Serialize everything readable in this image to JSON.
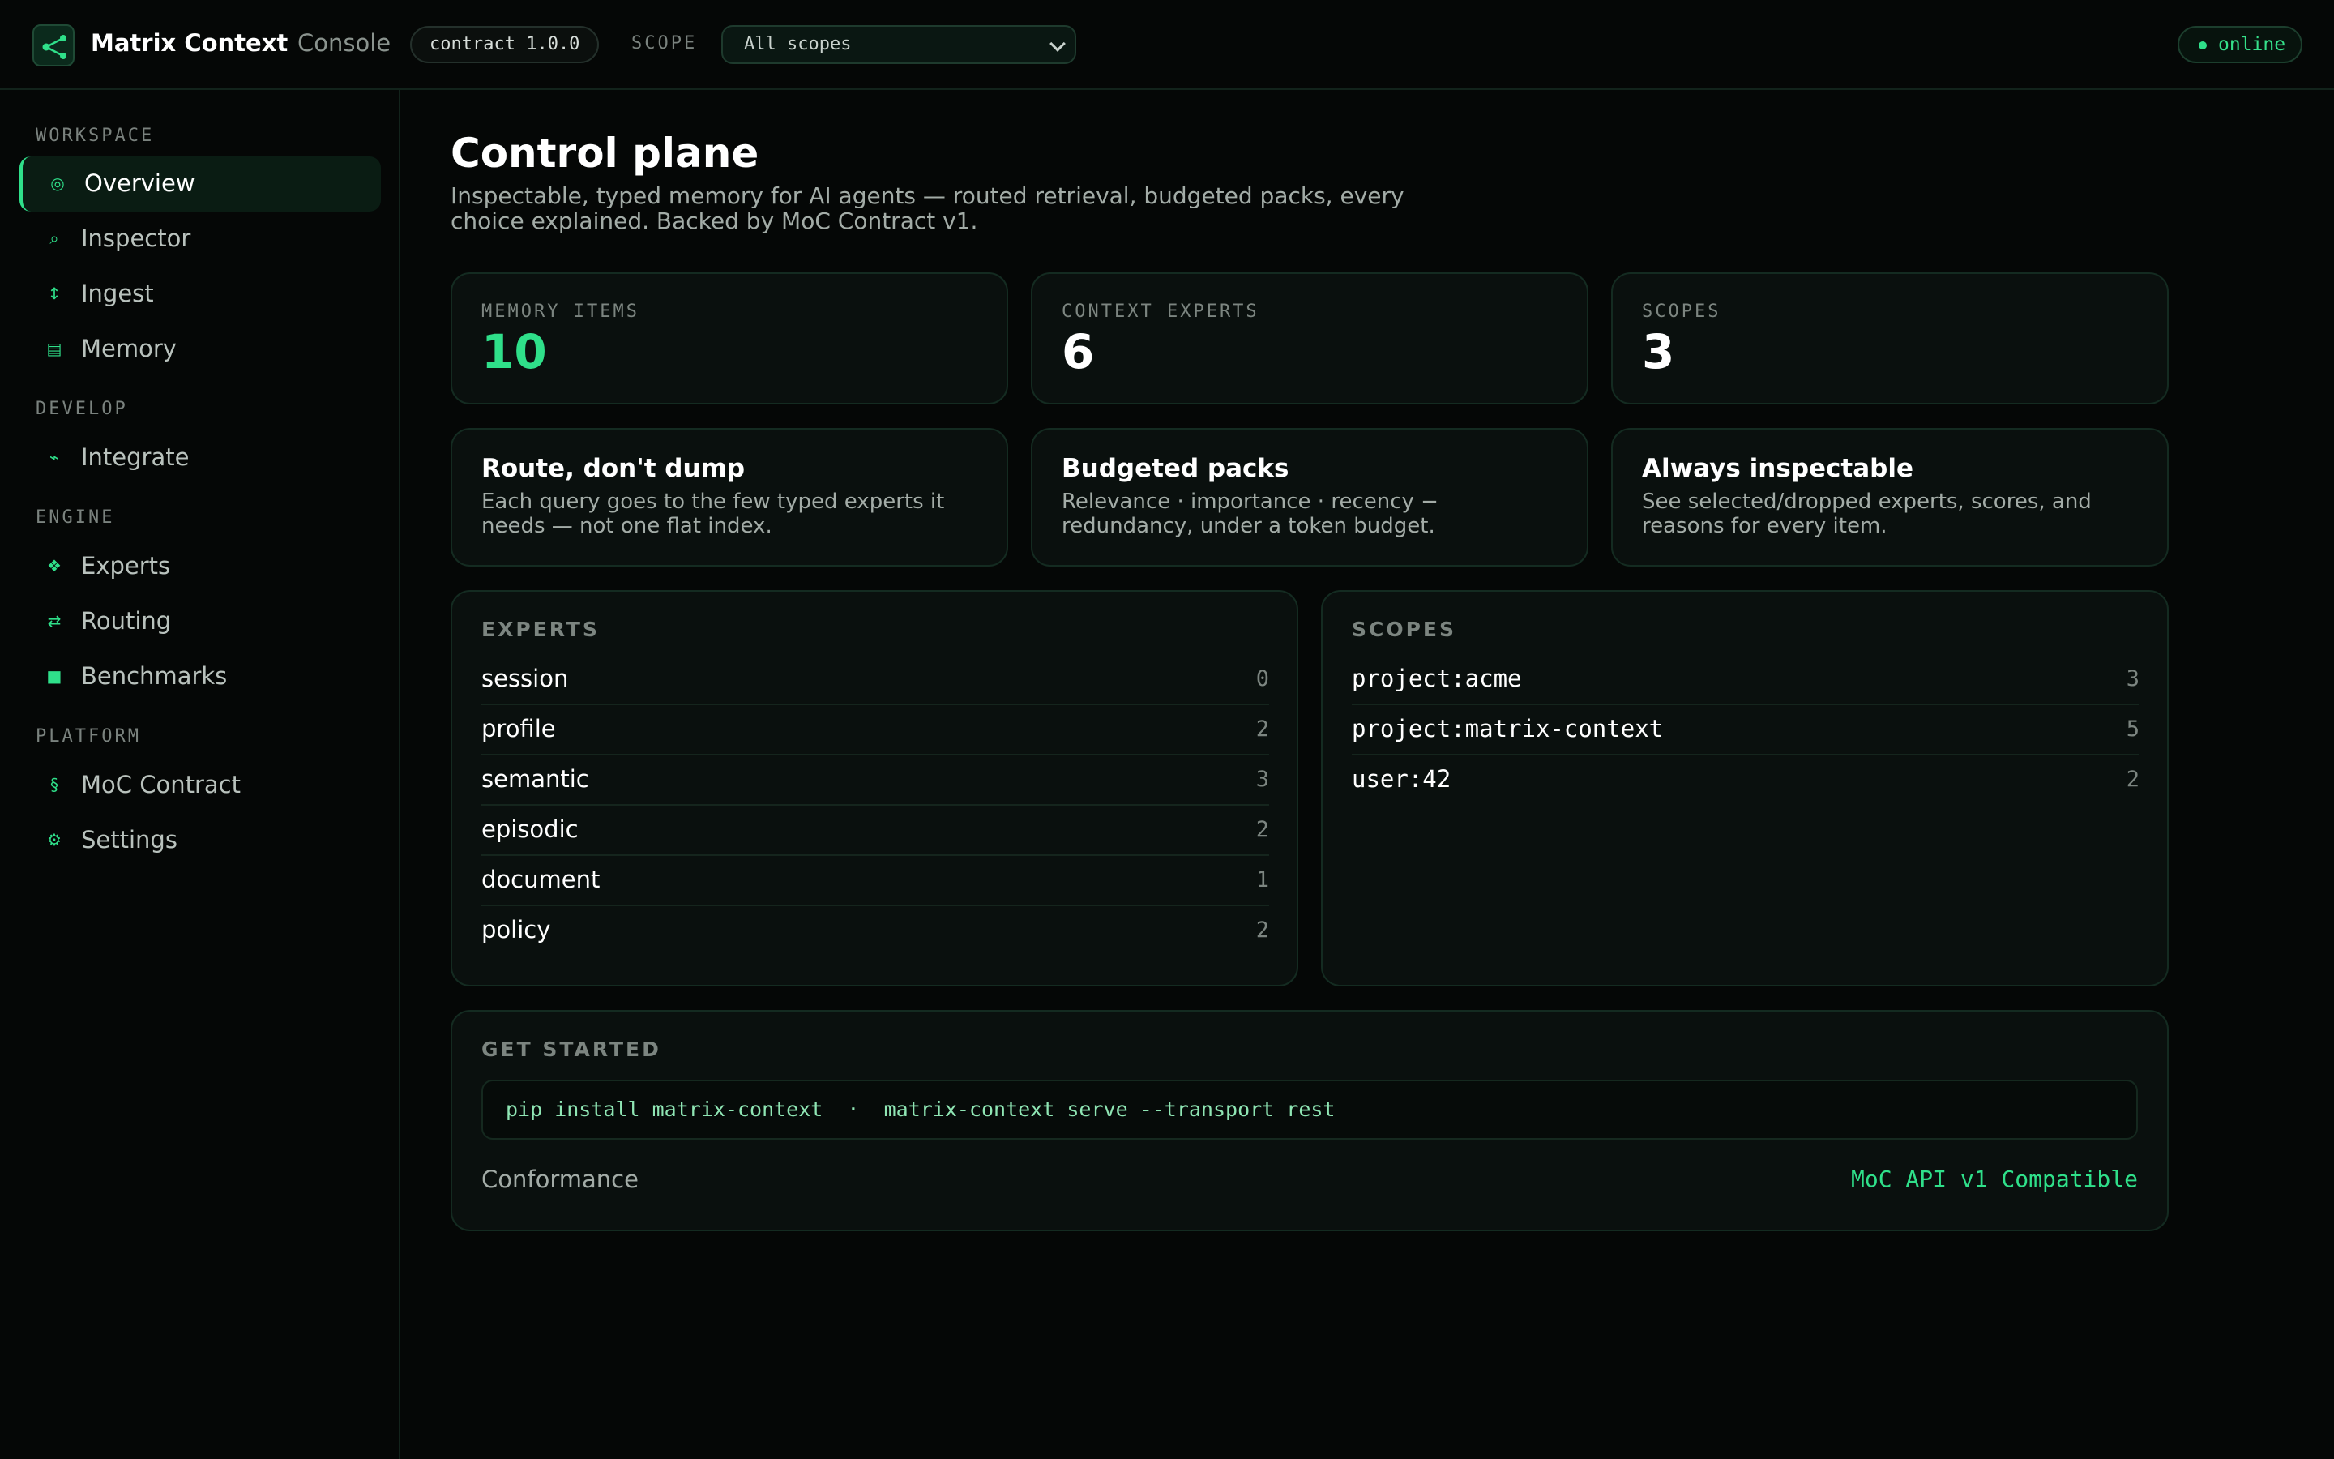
{
  "header": {
    "brand": "Matrix Context",
    "brand_sub": "Console",
    "contract_badge": "contract 1.0.0",
    "scope_label": "SCOPE",
    "scope_selected": "All scopes",
    "status": "online",
    "accent_color": "#2fe08a"
  },
  "sidebar": {
    "sections": [
      {
        "label": "WORKSPACE",
        "items": [
          {
            "label": "Overview",
            "icon": "target-icon",
            "glyph": "◎",
            "active": true
          },
          {
            "label": "Inspector",
            "icon": "search-icon",
            "glyph": "⌕"
          },
          {
            "label": "Ingest",
            "icon": "arrows-vertical-icon",
            "glyph": "↕"
          },
          {
            "label": "Memory",
            "icon": "grid-icon",
            "glyph": "▤"
          }
        ]
      },
      {
        "label": "DEVELOP",
        "items": [
          {
            "label": "Integrate",
            "icon": "plug-icon",
            "glyph": "⌁"
          }
        ]
      },
      {
        "label": "ENGINE",
        "items": [
          {
            "label": "Experts",
            "icon": "diamond-icon",
            "glyph": "❖"
          },
          {
            "label": "Routing",
            "icon": "swap-icon",
            "glyph": "⇄"
          },
          {
            "label": "Benchmarks",
            "icon": "square-icon",
            "glyph": "■"
          }
        ]
      },
      {
        "label": "PLATFORM",
        "items": [
          {
            "label": "MoC Contract",
            "icon": "section-icon",
            "glyph": "§"
          },
          {
            "label": "Settings",
            "icon": "gear-icon",
            "glyph": "⚙"
          }
        ]
      }
    ]
  },
  "main": {
    "title": "Control plane",
    "subtitle": "Inspectable, typed memory for AI agents — routed retrieval, budgeted packs, every choice explained. Backed by MoC Contract v1.",
    "stats": [
      {
        "label": "MEMORY ITEMS",
        "value": "10"
      },
      {
        "label": "CONTEXT EXPERTS",
        "value": "6"
      },
      {
        "label": "SCOPES",
        "value": "3"
      }
    ],
    "features": [
      {
        "title": "Route, don't dump",
        "desc": "Each query goes to the few typed experts it needs — not one flat index."
      },
      {
        "title": "Budgeted packs",
        "desc": "Relevance · importance · recency − redundancy, under a token budget."
      },
      {
        "title": "Always inspectable",
        "desc": "See selected/dropped experts, scores, and reasons for every item."
      }
    ],
    "experts": {
      "title": "EXPERTS",
      "rows": [
        {
          "name": "session",
          "count": "0"
        },
        {
          "name": "profile",
          "count": "2"
        },
        {
          "name": "semantic",
          "count": "3"
        },
        {
          "name": "episodic",
          "count": "2"
        },
        {
          "name": "document",
          "count": "1"
        },
        {
          "name": "policy",
          "count": "2"
        }
      ]
    },
    "scopes": {
      "title": "SCOPES",
      "rows": [
        {
          "name": "project:acme",
          "count": "3"
        },
        {
          "name": "project:matrix-context",
          "count": "5"
        },
        {
          "name": "user:42",
          "count": "2"
        }
      ]
    },
    "get_started": {
      "title": "GET STARTED",
      "command": "pip install matrix-context  ·  matrix-context serve --transport rest",
      "conformance_label": "Conformance",
      "conformance_value": "MoC API v1 Compatible"
    }
  }
}
